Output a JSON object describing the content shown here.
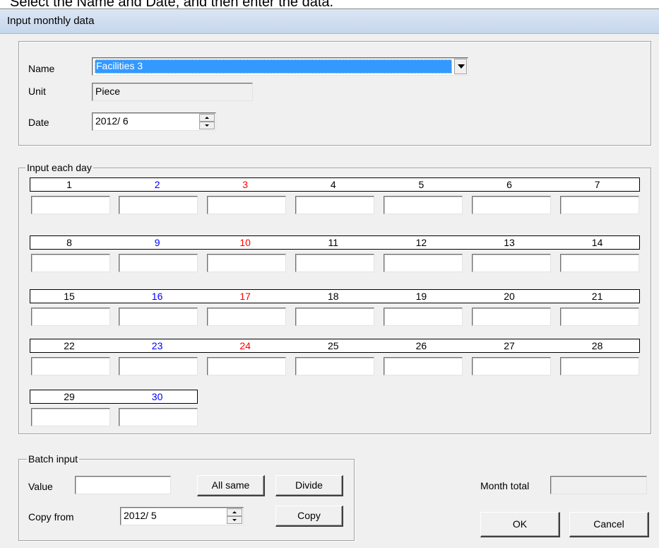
{
  "caption": "Select the Name and Date, and then enter the data.",
  "window": {
    "title": "Input monthly data"
  },
  "top_form": {
    "name_label": "Name",
    "name_value": "Facilities 3",
    "unit_label": "Unit",
    "unit_value": "Piece",
    "date_label": "Date",
    "date_value": "2012/ 6"
  },
  "days_group": {
    "legend": "Input each day",
    "rows": [
      [
        "1",
        "2",
        "3",
        "4",
        "5",
        "6",
        "7"
      ],
      [
        "8",
        "9",
        "10",
        "11",
        "12",
        "13",
        "14"
      ],
      [
        "15",
        "16",
        "17",
        "18",
        "19",
        "20",
        "21"
      ],
      [
        "22",
        "23",
        "24",
        "25",
        "26",
        "27",
        "28"
      ],
      [
        "29",
        "30"
      ]
    ]
  },
  "batch": {
    "legend": "Batch input",
    "value_label": "Value",
    "value": "",
    "all_same_label": "All same",
    "divide_label": "Divide",
    "copy_from_label": "Copy from",
    "copy_from_value": "2012/ 5",
    "copy_label": "Copy"
  },
  "totals": {
    "month_total_label": "Month total",
    "month_total_value": ""
  },
  "buttons": {
    "ok": "OK",
    "cancel": "Cancel"
  },
  "colors": {
    "saturday": "#0000ff",
    "sunday": "#ff0000",
    "selection": "#3399ff"
  }
}
